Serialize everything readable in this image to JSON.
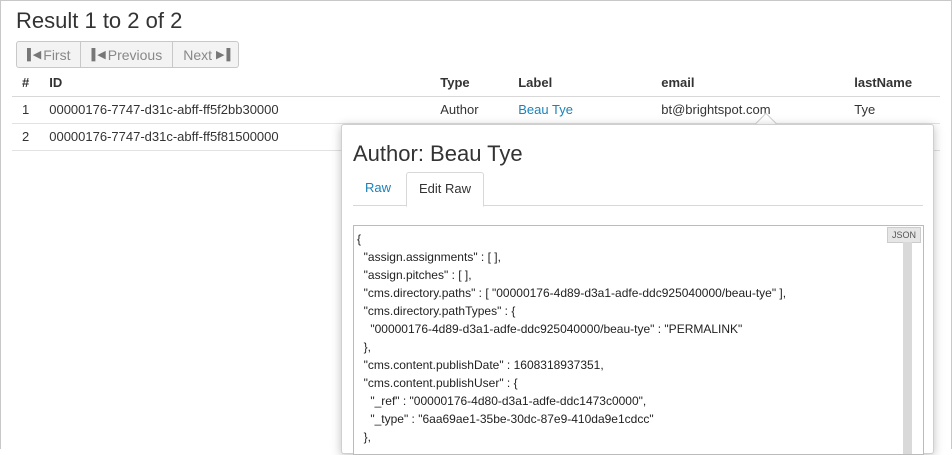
{
  "header": {
    "result_title": "Result 1 to 2 of 2"
  },
  "pager": {
    "first_label": "First",
    "previous_label": "Previous",
    "next_label": "Next"
  },
  "table": {
    "columns": [
      "#",
      "ID",
      "Type",
      "Label",
      "email",
      "lastName"
    ],
    "rows": [
      {
        "num": "1",
        "id": "00000176-7747-d31c-abff-ff5f2bb30000",
        "type": "Author",
        "label": "Beau Tye",
        "email": "bt@brightspot.com",
        "lastName": "Tye"
      },
      {
        "num": "2",
        "id": "00000176-7747-d31c-abff-ff5f81500000",
        "type": "",
        "label": "",
        "email": "",
        "lastName": ""
      }
    ]
  },
  "popup": {
    "title": "Author: Beau Tye",
    "tabs": {
      "raw": "Raw",
      "edit_raw": "Edit Raw"
    },
    "badge": "JSON",
    "code_lines": [
      "{",
      "  \"assign.assignments\" : [ ],",
      "  \"assign.pitches\" : [ ],",
      "  \"cms.directory.paths\" : [ \"00000176-4d89-d3a1-adfe-ddc925040000/beau-tye\" ],",
      "  \"cms.directory.pathTypes\" : {",
      "    \"00000176-4d89-d3a1-adfe-ddc925040000/beau-tye\" : \"PERMALINK\"",
      "  },",
      "  \"cms.content.publishDate\" : 1608318937351,",
      "  \"cms.content.publishUser\" : {",
      "    \"_ref\" : \"00000176-4d80-d3a1-adfe-ddc1473c0000\",",
      "    \"_type\" : \"6aa69ae1-35be-30dc-87e9-410da9e1cdcc\"",
      "  },"
    ]
  },
  "colors": {
    "link": "#1c82b8",
    "border": "#c8c8c8"
  }
}
